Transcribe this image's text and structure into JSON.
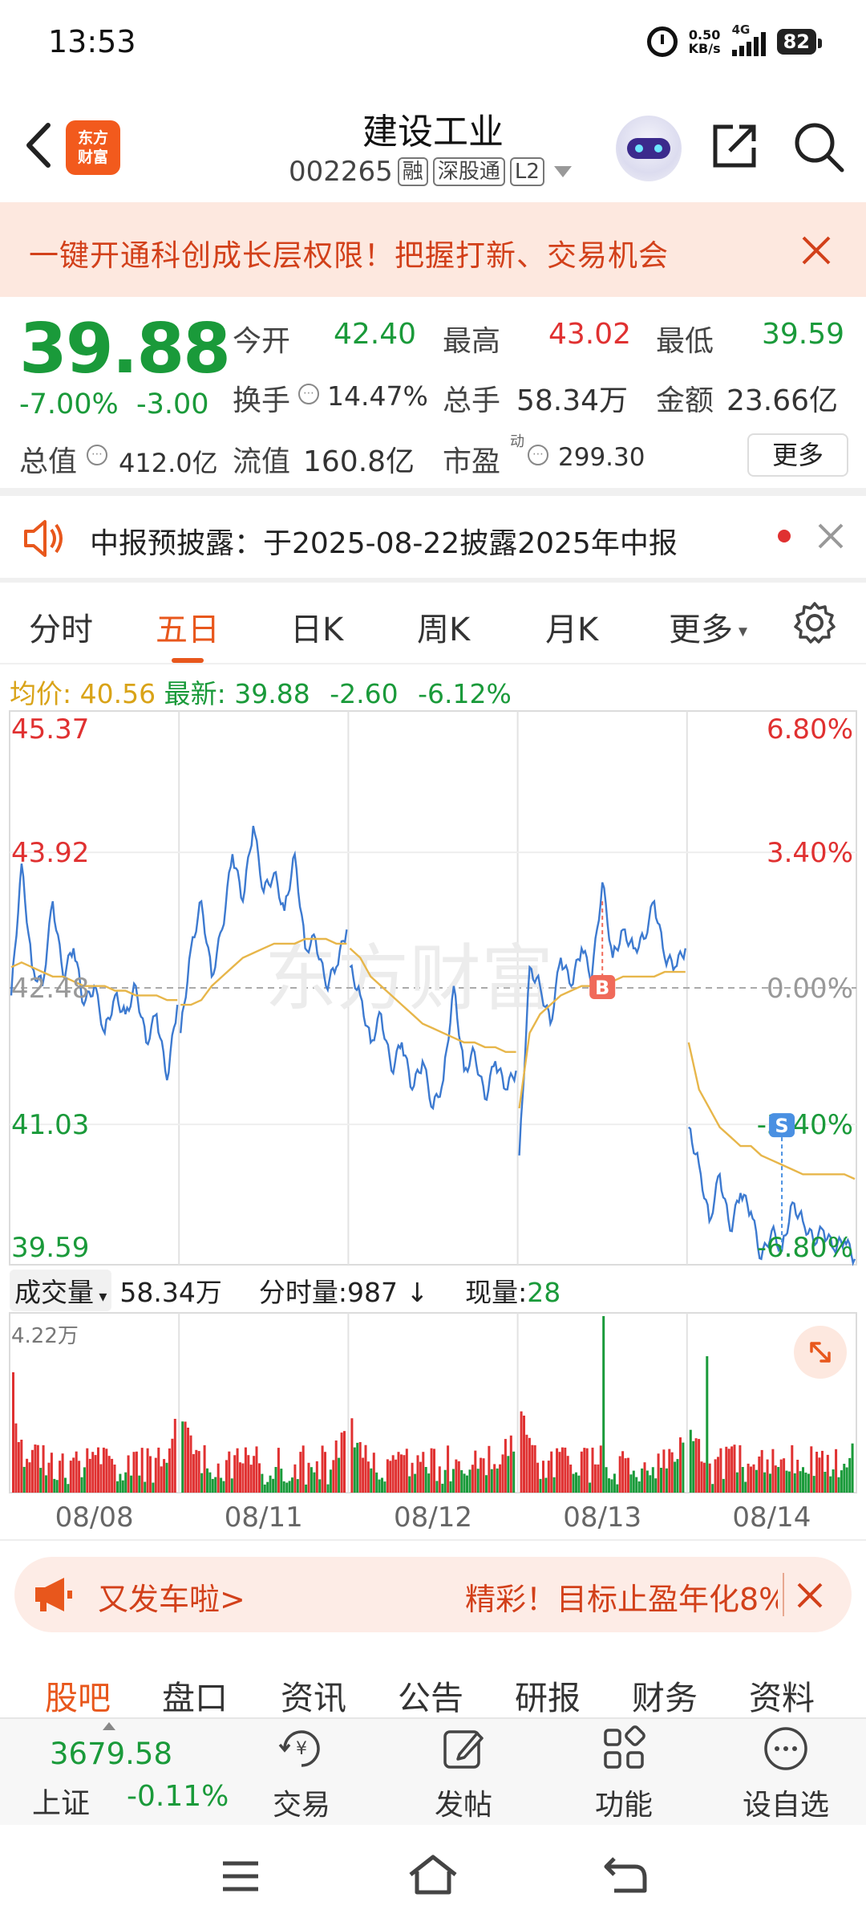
{
  "status": {
    "time": "13:53",
    "speed_value": "0.50",
    "speed_unit": "KB/s",
    "network": "4G",
    "battery": "82"
  },
  "header": {
    "title": "建设工业",
    "code": "002265",
    "tags": [
      "融",
      "深股通",
      "L2"
    ],
    "logo_line1": "东方",
    "logo_line2": "财富"
  },
  "banner": {
    "text": "一键开通科创成长层权限！把握打新、交易机会"
  },
  "quote": {
    "price": "39.88",
    "change_pct": "-7.00%",
    "change_abs": "-3.00",
    "open_label": "今开",
    "open": "42.40",
    "high_label": "最高",
    "high": "43.02",
    "low_label": "最低",
    "low": "39.59",
    "turnover_label": "换手",
    "turnover": "14.47%",
    "volume_label": "总手",
    "volume": "58.34万",
    "amount_label": "金额",
    "amount": "23.66亿",
    "mktcap_label": "总值",
    "mktcap": "412.0亿",
    "float_label": "流值",
    "float_cap": "160.8亿",
    "pe_label": "市盈",
    "pe_sup": "动",
    "pe": "299.30",
    "more": "更多"
  },
  "notice": {
    "text": "中报预披露：于2025-08-22披露2025年中报"
  },
  "tabs": [
    "分时",
    "五日",
    "日K",
    "周K",
    "月K",
    "更多"
  ],
  "active_tab": "五日",
  "summary": {
    "avg_label": "均价:",
    "avg": "40.56",
    "latest_label": "最新:",
    "latest": "39.88",
    "chg": "-2.60",
    "pct": "-6.12%"
  },
  "chart_data": {
    "type": "line",
    "title": "",
    "y_left_ticks": [
      "45.37",
      "43.92",
      "42.48",
      "41.03",
      "39.59"
    ],
    "y_right_ticks": [
      "6.80%",
      "3.40%",
      "0.00%",
      "-3.40%",
      "-6.80%"
    ],
    "ylim": [
      39.59,
      45.37
    ],
    "prev_close": 42.48,
    "x_labels": [
      "08/08",
      "08/11",
      "08/12",
      "08/13",
      "08/14"
    ],
    "markers": [
      {
        "label": "B",
        "day": 3,
        "pos": 0.5,
        "price": 43.4
      },
      {
        "label": "S",
        "day": 4,
        "pos": 0.56,
        "price": 39.7
      }
    ],
    "series": [
      {
        "values": [
          [
            42.4,
            43.8,
            42.7,
            42.5,
            43.4,
            42.6,
            42.9,
            42.3,
            42.5,
            42.0,
            42.4,
            42.2,
            42.5,
            41.9,
            42.2,
            41.5,
            42.3
          ],
          [
            42.0,
            42.9,
            43.4,
            42.6,
            43.1,
            43.9,
            43.4,
            44.2,
            43.5,
            43.7,
            43.3,
            43.9,
            42.9,
            43.0,
            42.5,
            42.7,
            43.1
          ],
          [
            42.7,
            42.4,
            41.9,
            42.2,
            41.6,
            41.9,
            41.4,
            41.7,
            41.2,
            41.5,
            42.5,
            41.6,
            41.8,
            41.3,
            41.7,
            41.4,
            41.6
          ],
          [
            40.7,
            42.7,
            42.5,
            42.1,
            42.8,
            42.5,
            42.9,
            42.6,
            43.6,
            42.8,
            43.1,
            42.9,
            43.0,
            43.4,
            42.8,
            42.7,
            42.9
          ],
          [
            41.0,
            40.6,
            40.0,
            40.5,
            39.9,
            40.3,
            40.1,
            39.6,
            39.9,
            39.7,
            40.2,
            40.0,
            39.8,
            39.9,
            39.7,
            39.8,
            39.6
          ]
        ]
      },
      {
        "values": [
          [
            42.7,
            42.75,
            42.7,
            42.65,
            42.6,
            42.6,
            42.55,
            42.5,
            42.5,
            42.5,
            42.45,
            42.45,
            42.4,
            42.4,
            42.4,
            42.35,
            42.35
          ],
          [
            42.3,
            42.3,
            42.35,
            42.5,
            42.6,
            42.7,
            42.8,
            42.85,
            42.9,
            42.95,
            42.95,
            42.95,
            43.0,
            43.0,
            43.0,
            42.95,
            42.95
          ],
          [
            42.9,
            42.8,
            42.6,
            42.5,
            42.4,
            42.3,
            42.2,
            42.1,
            42.05,
            42.0,
            41.95,
            41.9,
            41.9,
            41.85,
            41.85,
            41.8,
            41.8
          ],
          [
            41.2,
            42.0,
            42.2,
            42.3,
            42.4,
            42.45,
            42.5,
            42.5,
            42.55,
            42.55,
            42.6,
            42.6,
            42.6,
            42.6,
            42.65,
            42.65,
            42.65
          ],
          [
            41.9,
            41.4,
            41.2,
            41.0,
            40.9,
            40.8,
            40.8,
            40.7,
            40.65,
            40.6,
            40.55,
            40.5,
            40.5,
            40.5,
            40.5,
            40.5,
            40.45
          ]
        ]
      }
    ]
  },
  "volume": {
    "selector": "成交量",
    "total": "58.34万",
    "tick_label": "分时量:",
    "tick_value": "987",
    "now_label": "现量:",
    "now_value": "28",
    "max_label": "4.22万"
  },
  "promo": {
    "left": "又发车啦>",
    "right": "精彩！目标止盈年化8%"
  },
  "bottom_tabs": [
    "股吧",
    "盘口",
    "资讯",
    "公告",
    "研报",
    "财务",
    "资料"
  ],
  "active_bottom_tab": "股吧",
  "index": {
    "value": "3679.58",
    "name": "上证",
    "change": "-0.11%"
  },
  "nav": [
    "交易",
    "发帖",
    "功能",
    "设自选"
  ],
  "colors": {
    "up": "#e03131",
    "down": "#1a9a3a",
    "accent": "#e8571c",
    "price_line": "#3d7ad0",
    "avg_line": "#e7b64a"
  }
}
